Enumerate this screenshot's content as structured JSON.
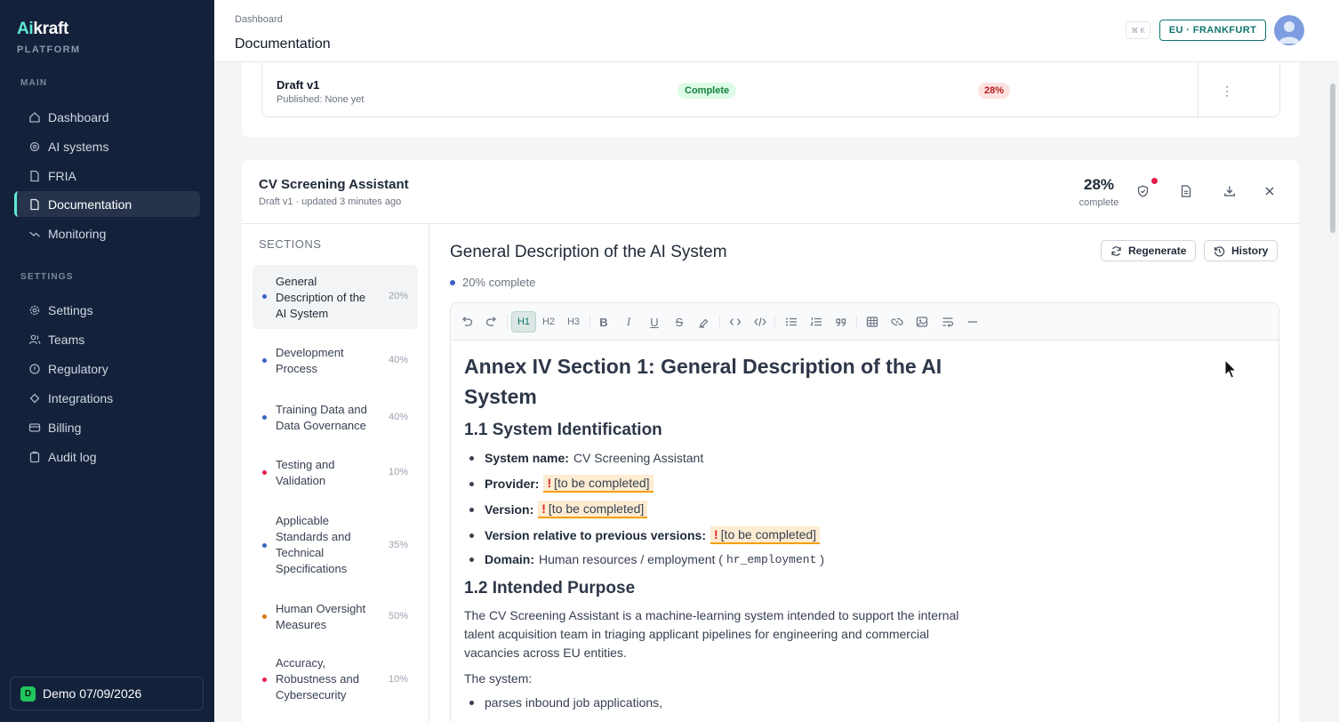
{
  "brand": {
    "name_a": "Ai",
    "name_b": "kraft",
    "subtitle": "PLATFORM"
  },
  "sidebar": {
    "main_label": "MAIN",
    "settings_label": "SETTINGS",
    "main_items": [
      {
        "label": "Dashboard",
        "icon": "home-icon"
      },
      {
        "label": "AI systems",
        "icon": "cog-chip-icon"
      },
      {
        "label": "FRIA",
        "icon": "file-icon"
      },
      {
        "label": "Documentation",
        "icon": "document-icon",
        "active": true
      },
      {
        "label": "Monitoring",
        "icon": "trend-icon"
      }
    ],
    "settings_items": [
      {
        "label": "Settings",
        "icon": "gear-icon"
      },
      {
        "label": "Teams",
        "icon": "users-icon"
      },
      {
        "label": "Regulatory",
        "icon": "scale-icon"
      },
      {
        "label": "Integrations",
        "icon": "puzzle-icon"
      },
      {
        "label": "Billing",
        "icon": "card-icon"
      },
      {
        "label": "Audit log",
        "icon": "clipboard-icon"
      }
    ],
    "workspace": {
      "badge": "D",
      "label": "Demo 07/09/2026"
    }
  },
  "topbar": {
    "breadcrumb": "Dashboard",
    "title": "Documentation",
    "shortcut": "⌘ K",
    "region": "EU · FRANKFURT"
  },
  "version_row": {
    "name": "Draft v1",
    "published": "Published: None yet",
    "status": "Complete",
    "completion": "28%"
  },
  "system": {
    "title": "CV Screening Assistant",
    "subtitle": "Draft v1 · updated 3 minutes ago",
    "completion": "28%",
    "completion_label": "complete"
  },
  "sections": {
    "title": "SECTIONS",
    "items": [
      {
        "label": "General Description of the AI System",
        "pct": "20%",
        "color": "#3b63c4",
        "active": true
      },
      {
        "label": "Development Process",
        "pct": "40%",
        "color": "#3b63c4"
      },
      {
        "label": "Training Data and Data Governance",
        "pct": "40%",
        "color": "#3b63c4"
      },
      {
        "label": "Testing and Validation",
        "pct": "10%",
        "color": "#e11d48"
      },
      {
        "label": "Applicable Standards and Technical Specifications",
        "pct": "35%",
        "color": "#3b63c4"
      },
      {
        "label": "Human Oversight Measures",
        "pct": "50%",
        "color": "#d97706"
      },
      {
        "label": "Accuracy, Robustness and Cybersecurity",
        "pct": "10%",
        "color": "#e11d48"
      }
    ]
  },
  "content": {
    "heading": "General Description of the AI System",
    "status": "20% complete",
    "regenerate": "Regenerate",
    "history": "History",
    "toolbar": {
      "h1": "H1",
      "h2": "H2",
      "h3": "H3"
    },
    "doc": {
      "h1": "Annex IV Section 1: General Description of the AI System",
      "h2_1": "1.1 System Identification",
      "items": [
        {
          "label": "System name:",
          "value": "CV Screening Assistant"
        },
        {
          "label": "Provider:",
          "todo": "[to be completed]"
        },
        {
          "label": "Version:",
          "todo": "[to be completed]"
        },
        {
          "label": "Version relative to previous versions:",
          "todo": "[to be completed]"
        },
        {
          "label": "Domain:",
          "value_pre": "Human resources / employment (",
          "code": "hr_employment",
          "value_post": ")"
        }
      ],
      "todo_mark": "!",
      "h2_2": "1.2 Intended Purpose",
      "para": "The CV Screening Assistant is a machine-learning system intended to support the internal talent acquisition team in triaging applicant pipelines for engineering and commercial vacancies across EU entities.",
      "para2": "The system:",
      "bullet": "parses inbound job applications,"
    }
  }
}
